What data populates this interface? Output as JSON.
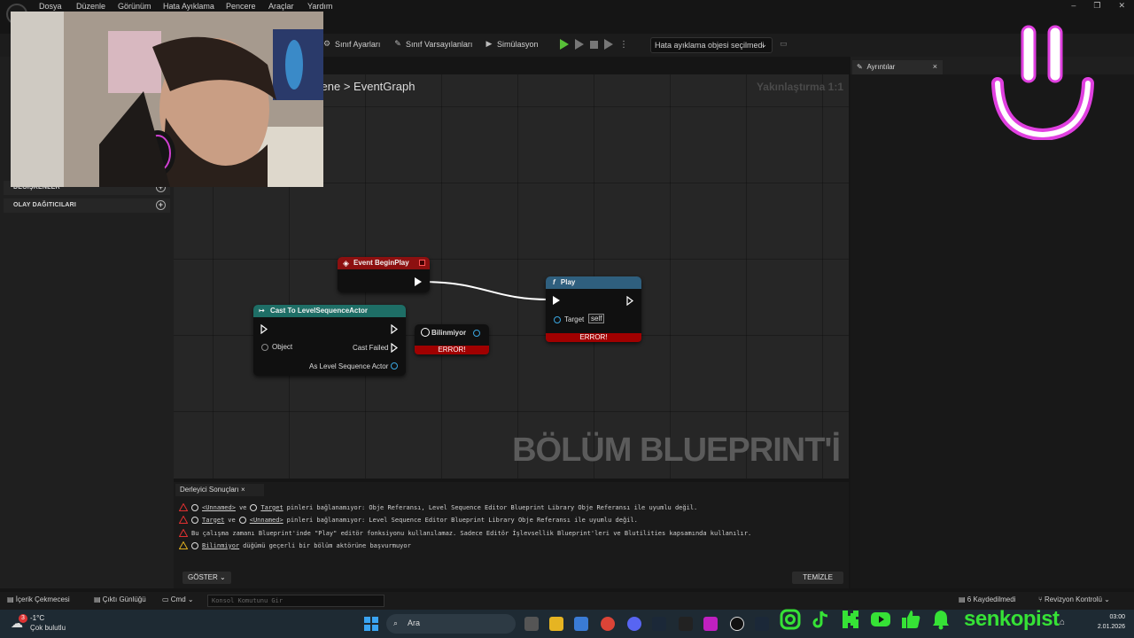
{
  "menu": [
    "Dosya",
    "Düzenle",
    "Görünüm",
    "Hata Ayıklama",
    "Pencere",
    "Araçlar",
    "Yardım"
  ],
  "window_controls": [
    "–",
    "❐",
    "✕"
  ],
  "toolbar": {
    "class_settings": "Sınıf Ayarları",
    "class_defaults": "Sınıf Varsayılanları",
    "simulation": "Simülasyon",
    "debug_object": "Hata ayıklama objesi seçilmedi"
  },
  "left_panel": {
    "variables": "DEĞİŞKENLER",
    "event_dispatchers": "OLAY DAĞITICILARI"
  },
  "graph": {
    "breadcrumb_prefix": "cene",
    "breadcrumb_sep": ">",
    "breadcrumb_current": "EventGraph",
    "zoom": "Yakınlaştırma 1:1",
    "watermark": "BÖLÜM BLUEPRINT'İ"
  },
  "nodes": {
    "begin_play": {
      "title": "Event BeginPlay"
    },
    "play": {
      "title": "Play",
      "target_label": "Target",
      "target_value": "self",
      "error": "ERROR!"
    },
    "cast": {
      "title": "Cast To LevelSequenceActor",
      "object": "Object",
      "cast_failed": "Cast Failed",
      "as_actor": "As Level Sequence Actor"
    },
    "unknown": {
      "title": "Bilinmiyor",
      "error": "ERROR!"
    }
  },
  "details": {
    "tab": "Ayrıntılar",
    "close": "×"
  },
  "compiler": {
    "tab": "Derleyici Sonuçları",
    "tab_close": "×",
    "messages": [
      {
        "kind": "error",
        "a": "<Unnamed>",
        "b": "ve",
        "c": "Target",
        "rest": "pinleri bağlanamıyor: Obje Referansı, Level Sequence Editor Blueprint Library Obje Referansı ile uyumlu değil."
      },
      {
        "kind": "error",
        "a": "Target",
        "b": "ve",
        "c": "<Unnamed>",
        "rest": "pinleri bağlanamıyor: Level Sequence Editor Blueprint Library Obje Referansı ile uyumlu değil."
      },
      {
        "kind": "error",
        "text": "Bu çalışma zamanı Blueprint'inde \"Play\" editör fonksiyonu kullanılamaz. Sadece Editör İşlevsellik Blueprint'leri ve Blutilities kapsamında kullanılır."
      },
      {
        "kind": "warning",
        "a": "Bilinmiyor",
        "rest": "düğümü geçerli bir bölüm aktörüne başvurmuyor"
      }
    ],
    "show": "GÖSTER",
    "clear": "TEMİZLE"
  },
  "statusbar": {
    "content_drawer": "İçerik Çekmecesi",
    "output_log": "Çıktı Günlüğü",
    "cmd": "Cmd",
    "console_placeholder": "Konsol Komutunu Gir",
    "saved": "6 Kaydedilmedi",
    "revision": "Revizyon Kontrolü"
  },
  "taskbar": {
    "temperature": "-1°C",
    "weather": "Çok bulutlu",
    "weather_badge": "3",
    "search": "Ara",
    "time": "03:00",
    "date": "2.01.2026"
  },
  "overlay": {
    "brand": "senkopist"
  },
  "colors": {
    "event_head": "#8c1010",
    "play_head": "#2f5f7e",
    "cast_head": "#1e6e66",
    "error": "#a00000",
    "pin_blue": "#3aa6e0",
    "brand_green": "#36e236",
    "smiley_pink": "#e040e0"
  }
}
